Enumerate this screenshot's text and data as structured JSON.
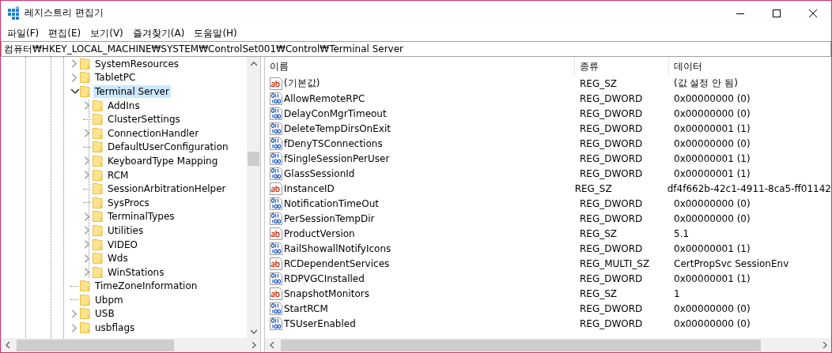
{
  "window": {
    "title": "레지스트리 편집기"
  },
  "menu": [
    "파일(F)",
    "편집(E)",
    "보기(V)",
    "즐겨찾기(A)",
    "도움말(H)"
  ],
  "address": "컴퓨터₩HKEY_LOCAL_MACHINE₩SYSTEM₩ControlSet001₩Control₩Terminal Server",
  "tree": [
    {
      "label": "SystemResources",
      "expanded": false,
      "selected": false
    },
    {
      "label": "TabletPC",
      "expanded": false,
      "selected": false
    },
    {
      "label": "Terminal Server",
      "expanded": true,
      "selected": true,
      "children": [
        {
          "label": "AddIns",
          "expanded": false,
          "selected": false
        },
        {
          "label": "ClusterSettings",
          "selected": false
        },
        {
          "label": "ConnectionHandler",
          "expanded": false,
          "selected": false
        },
        {
          "label": "DefaultUserConfiguration",
          "selected": false
        },
        {
          "label": "KeyboardType Mapping",
          "expanded": false,
          "selected": false
        },
        {
          "label": "RCM",
          "expanded": false,
          "selected": false
        },
        {
          "label": "SessionArbitrationHelper",
          "selected": false
        },
        {
          "label": "SysProcs",
          "selected": false
        },
        {
          "label": "TerminalTypes",
          "expanded": false,
          "selected": false
        },
        {
          "label": "Utilities",
          "expanded": false,
          "selected": false
        },
        {
          "label": "VIDEO",
          "expanded": false,
          "selected": false
        },
        {
          "label": "Wds",
          "expanded": false,
          "selected": false
        },
        {
          "label": "WinStations",
          "expanded": false,
          "selected": false
        }
      ]
    },
    {
      "label": "TimeZoneInformation",
      "selected": false
    },
    {
      "label": "Ubpm",
      "selected": false
    },
    {
      "label": "USB",
      "expanded": false,
      "selected": false
    },
    {
      "label": "usbflags",
      "expanded": false,
      "selected": false
    }
  ],
  "table": {
    "columns": [
      "이름",
      "종류",
      "데이터"
    ],
    "rows": [
      {
        "kind": "string",
        "name": "(기본값)",
        "type": "REG_SZ",
        "data": "(값 설정 안 됨)"
      },
      {
        "kind": "binary",
        "name": "AllowRemoteRPC",
        "type": "REG_DWORD",
        "data": "0x00000000 (0)"
      },
      {
        "kind": "binary",
        "name": "DelayConMgrTimeout",
        "type": "REG_DWORD",
        "data": "0x00000000 (0)"
      },
      {
        "kind": "binary",
        "name": "DeleteTempDirsOnExit",
        "type": "REG_DWORD",
        "data": "0x00000001 (1)"
      },
      {
        "kind": "binary",
        "name": "fDenyTSConnections",
        "type": "REG_DWORD",
        "data": "0x00000000 (0)"
      },
      {
        "kind": "binary",
        "name": "fSingleSessionPerUser",
        "type": "REG_DWORD",
        "data": "0x00000001 (1)"
      },
      {
        "kind": "binary",
        "name": "GlassSessionId",
        "type": "REG_DWORD",
        "data": "0x00000001 (1)"
      },
      {
        "kind": "string",
        "name": "InstanceID",
        "type": "REG_SZ",
        "data": "df4f662b-42c1-4911-8ca5-ff01142"
      },
      {
        "kind": "binary",
        "name": "NotificationTimeOut",
        "type": "REG_DWORD",
        "data": "0x00000000 (0)"
      },
      {
        "kind": "binary",
        "name": "PerSessionTempDir",
        "type": "REG_DWORD",
        "data": "0x00000000 (0)"
      },
      {
        "kind": "string",
        "name": "ProductVersion",
        "type": "REG_SZ",
        "data": "5.1"
      },
      {
        "kind": "binary",
        "name": "RailShowallNotifyIcons",
        "type": "REG_DWORD",
        "data": "0x00000001 (1)"
      },
      {
        "kind": "string",
        "name": "RCDependentServices",
        "type": "REG_MULTI_SZ",
        "data": "CertPropSvc SessionEnv"
      },
      {
        "kind": "binary",
        "name": "RDPVGCInstalled",
        "type": "REG_DWORD",
        "data": "0x00000001 (1)"
      },
      {
        "kind": "string",
        "name": "SnapshotMonitors",
        "type": "REG_SZ",
        "data": "1"
      },
      {
        "kind": "binary",
        "name": "StartRCM",
        "type": "REG_DWORD",
        "data": "0x00000000 (0)"
      },
      {
        "kind": "binary",
        "name": "TSUserEnabled",
        "type": "REG_DWORD",
        "data": "0x00000000 (0)"
      }
    ]
  }
}
